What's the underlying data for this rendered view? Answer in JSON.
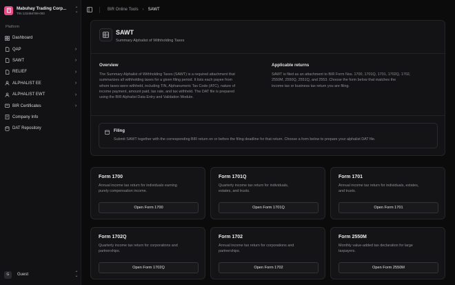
{
  "org": {
    "name": "Mabuhay Trading Corp...",
    "tin": "TIN 123456789-000"
  },
  "sidebar": {
    "section_label": "Platform",
    "items": [
      {
        "label": "Dashboard",
        "icon": "grid-icon",
        "expandable": false
      },
      {
        "label": "QAP",
        "icon": "file-icon",
        "expandable": true
      },
      {
        "label": "SAWT",
        "icon": "file-icon",
        "expandable": true
      },
      {
        "label": "RELIEF",
        "icon": "file-icon",
        "expandable": true
      },
      {
        "label": "ALPHALIST EE",
        "icon": "users-icon",
        "expandable": true
      },
      {
        "label": "ALPHALIST EWT",
        "icon": "users-icon",
        "expandable": true
      },
      {
        "label": "BIR Certificates",
        "icon": "certificate-icon",
        "expandable": true
      },
      {
        "label": "Company Info",
        "icon": "building-icon",
        "expandable": false
      },
      {
        "label": "DAT Repository",
        "icon": "database-icon",
        "expandable": false
      }
    ]
  },
  "user": {
    "initial": "G",
    "name": "Guest"
  },
  "breadcrumb": {
    "parent": "BIR Online Tools",
    "current": "SAWT"
  },
  "intro": {
    "title": "SAWT",
    "subtitle": "Summary Alphalist of Withholding Taxes",
    "overview_heading": "Overview",
    "overview_lines": [
      "The Summary Alphalist of Withholding Taxes (SAWT) is a required attachment that",
      "summarizes all withholding taxes for a given filing period. It lists each payee from",
      "whom taxes were withheld, including TIN, Alphanumeric Tax Code (ATC), nature of",
      "income payment, amount paid, tax rate, and tax withheld. The DAT file is prepared",
      "using the BIR Alphalist Data Entry and Validation Module."
    ],
    "returns_heading": "Applicable returns",
    "returns_lines": [
      "SAWT is filed as an attachment to BIR Form Nos. 1700, 1701Q, 1701, 1702Q, 1702,",
      "2550M, 2550Q, 2551Q, and 2553. Choose the form below that matches the",
      "income tax or business tax return you are filing."
    ],
    "filing_title": "Filing",
    "filing_text": "Submit SAWT together with the corresponding BIR return on or before the filing deadline for that return. Choose a form below to prepare your alphalist DAT file."
  },
  "forms": [
    {
      "title": "Form 1700",
      "desc_lines": [
        "Annual income tax return for individuals earning",
        "purely compensation income."
      ],
      "button": "Open Form 1700"
    },
    {
      "title": "Form 1701Q",
      "desc_lines": [
        "Quarterly income tax return for individuals,",
        "estates, and trusts."
      ],
      "button": "Open Form 1701Q"
    },
    {
      "title": "Form 1701",
      "desc_lines": [
        "Annual income tax return for individuals, estates,",
        "and trusts."
      ],
      "button": "Open Form 1701"
    },
    {
      "title": "Form 1702Q",
      "desc_lines": [
        "Quarterly income tax return for corporations and",
        "partnerships."
      ],
      "button": "Open Form 1702Q"
    },
    {
      "title": "Form 1702",
      "desc_lines": [
        "Annual income tax return for corporations and",
        "partnerships."
      ],
      "button": "Open Form 1702"
    },
    {
      "title": "Form 2550M",
      "desc_lines": [
        "Monthly value-added tax declaration for large",
        "taxpayers."
      ],
      "button": "Open Form 2550M"
    }
  ],
  "colors": {
    "background": "#0b0b0c",
    "sidebar": "#121214",
    "card": "#141416",
    "brand": "#e64b87",
    "text_primary": "#ececef",
    "text_muted": "#8e8e95"
  }
}
